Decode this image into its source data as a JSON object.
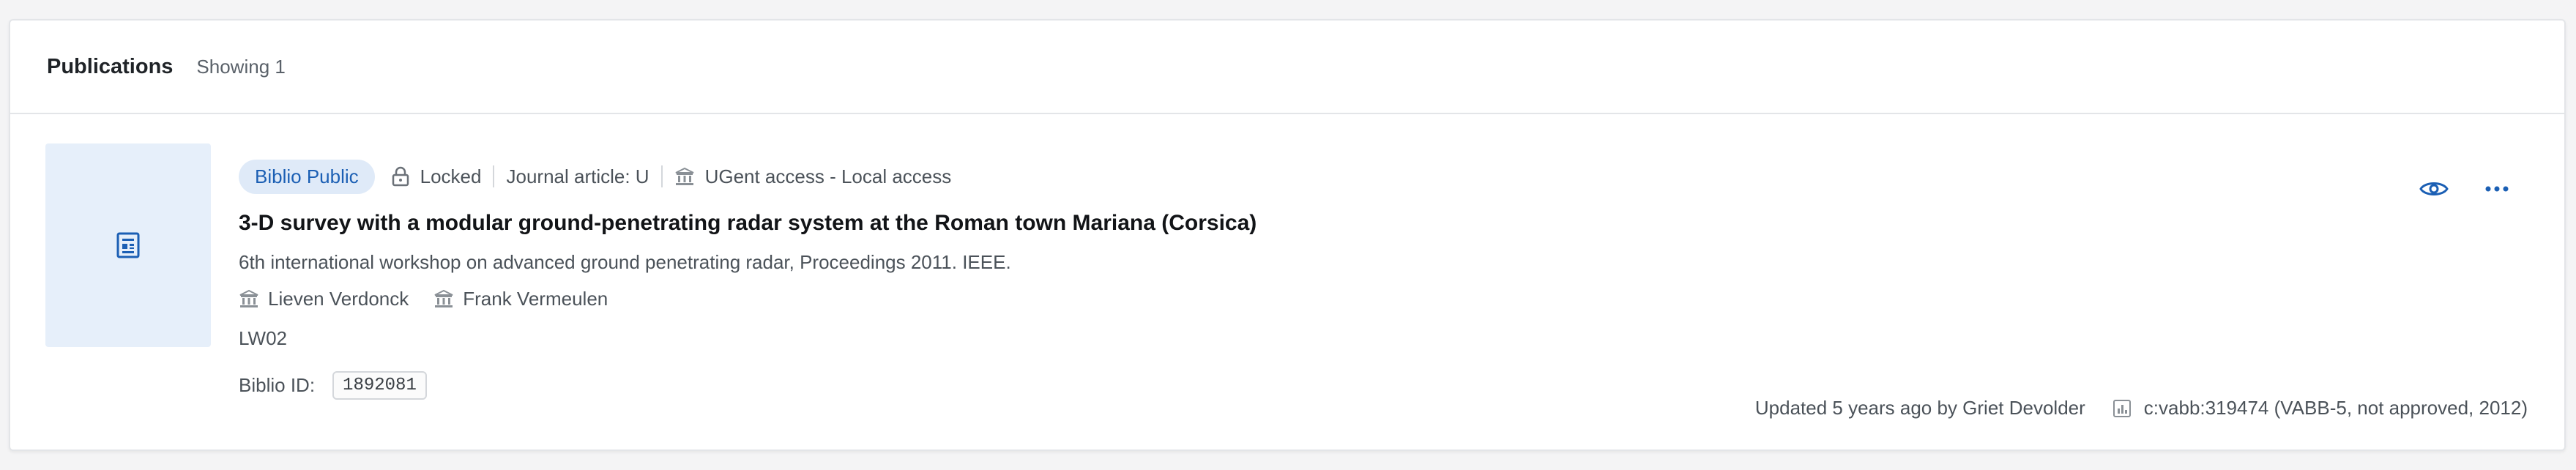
{
  "header": {
    "title": "Publications",
    "count": "Showing 1"
  },
  "publication": {
    "thumbnail_icon": "document-icon",
    "badge": "Biblio Public",
    "lock_status": "Locked",
    "type": "Journal article: U",
    "access": "UGent access - Local access",
    "title": "3-D survey with a modular ground-penetrating radar system at the Roman town Mariana (Corsica)",
    "source": "6th international workshop on advanced ground penetrating radar, Proceedings 2011. IEEE.",
    "authors": [
      "Lieven Verdonck",
      "Frank Vermeulen"
    ],
    "department": "LW02",
    "id_label": "Biblio ID:",
    "id_value": "1892081",
    "updated": "Updated 5 years ago by Griet Devolder",
    "vabb": "c:vabb:319474 (VABB-5, not approved, 2012)"
  },
  "colors": {
    "accent": "#1b5fb4",
    "badge_bg": "#dfeaf8",
    "thumb_bg": "#e6effa",
    "border": "#e3e5e8"
  }
}
